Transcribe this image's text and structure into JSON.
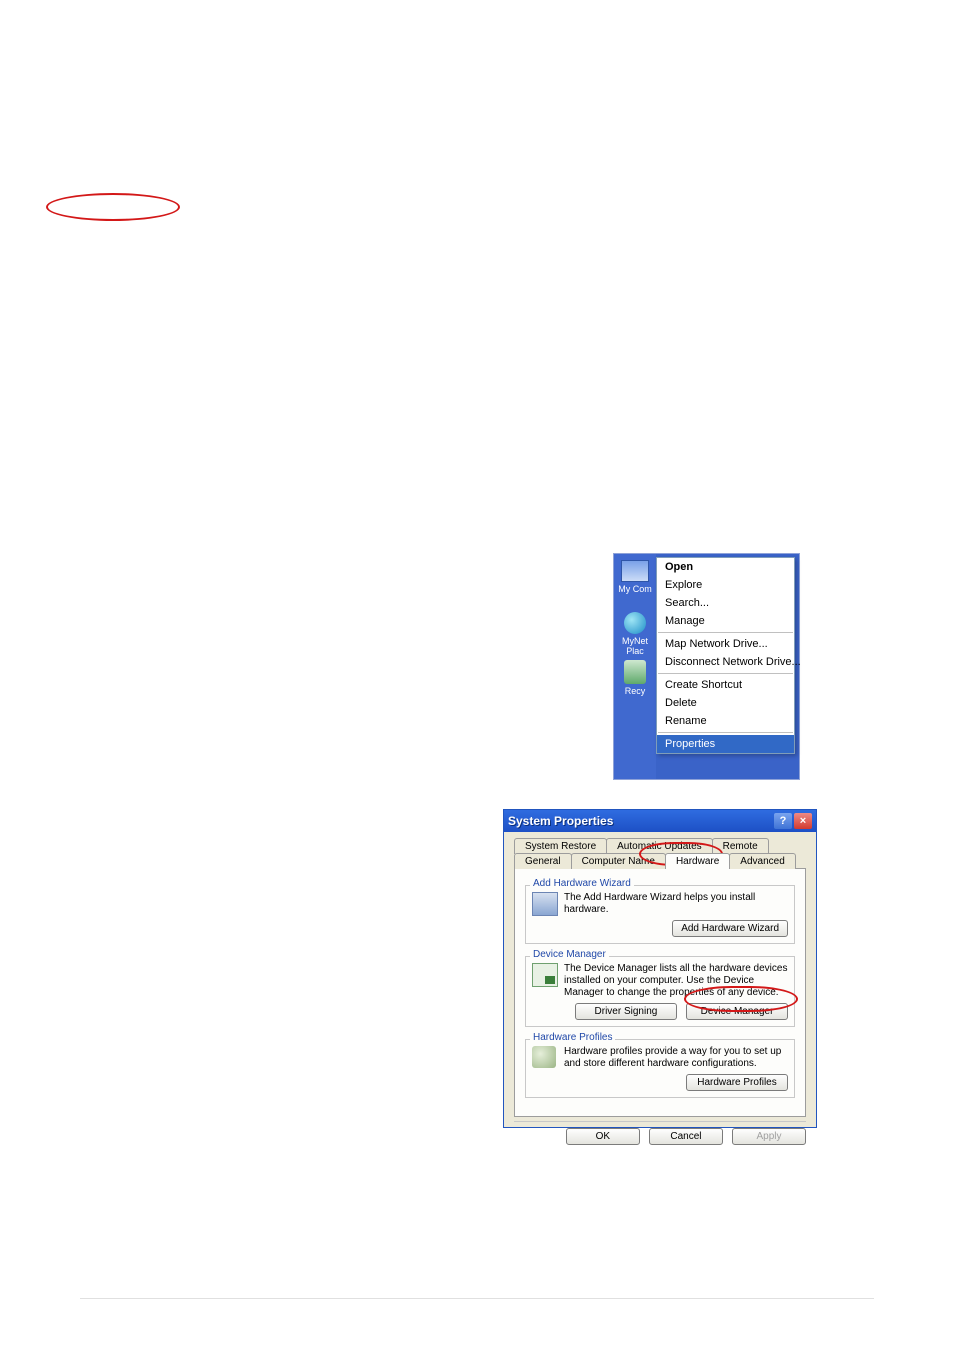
{
  "context_menu": {
    "icons": {
      "my_computer": "My Com",
      "my_network": "MyNet\nPlac",
      "recycle": "Recy"
    },
    "items": [
      {
        "label": "Open",
        "bold": true
      },
      {
        "label": "Explore"
      },
      {
        "label": "Search..."
      },
      {
        "label": "Manage"
      },
      {
        "sep": true
      },
      {
        "label": "Map Network Drive..."
      },
      {
        "label": "Disconnect Network Drive..."
      },
      {
        "sep": true
      },
      {
        "label": "Create Shortcut"
      },
      {
        "label": "Delete"
      },
      {
        "label": "Rename"
      },
      {
        "sep": true
      },
      {
        "label": "Properties",
        "selected": true
      }
    ]
  },
  "dialog": {
    "title": "System Properties",
    "tabs_row1": [
      "System Restore",
      "Automatic Updates",
      "Remote"
    ],
    "tabs_row2": [
      "General",
      "Computer Name",
      "Hardware",
      "Advanced"
    ],
    "selected_tab": "Hardware",
    "groups": {
      "add_hw": {
        "title": "Add Hardware Wizard",
        "text": "The Add Hardware Wizard helps you install hardware.",
        "button": "Add Hardware Wizard"
      },
      "dev_mgr": {
        "title": "Device Manager",
        "text": "The Device Manager lists all the hardware devices installed on your computer. Use the Device Manager to change the properties of any device.",
        "button1": "Driver Signing",
        "button2": "Device Manager"
      },
      "hw_prof": {
        "title": "Hardware Profiles",
        "text": "Hardware profiles provide a way for you to set up and store different hardware configurations.",
        "button": "Hardware Profiles"
      }
    },
    "actions": {
      "ok": "OK",
      "cancel": "Cancel",
      "apply": "Apply"
    }
  }
}
